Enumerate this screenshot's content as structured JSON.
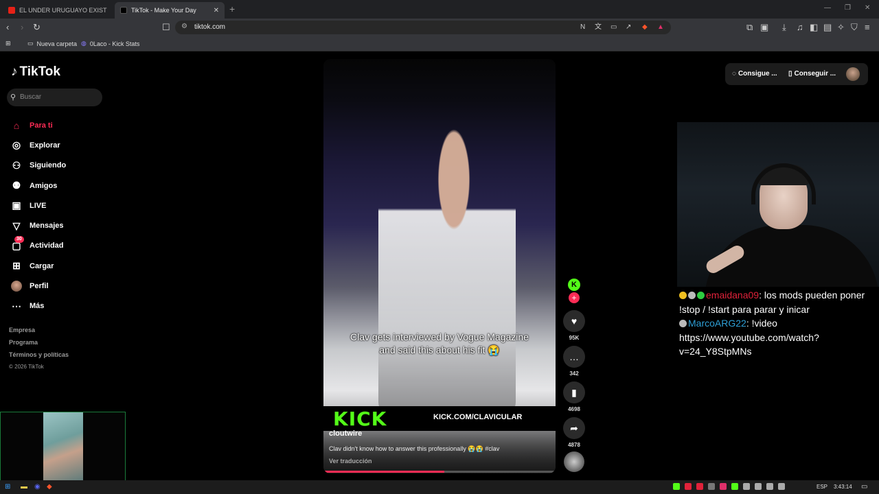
{
  "browser": {
    "tabs": [
      {
        "title": "EL UNDER URUGUAYO EXISTE? (cong",
        "active": false
      },
      {
        "title": "TikTok - Make Your Day",
        "active": true
      }
    ],
    "new_tab": "+",
    "url": "tiktok.com",
    "bookmarks": [
      "Nueva carpeta",
      "0Laco - Kick Stats"
    ]
  },
  "sidebar": {
    "logo": "TikTok",
    "search_placeholder": "Buscar",
    "items": [
      {
        "label": "Para ti",
        "icon": "home-icon"
      },
      {
        "label": "Explorar",
        "icon": "compass-icon"
      },
      {
        "label": "Siguiendo",
        "icon": "following-icon"
      },
      {
        "label": "Amigos",
        "icon": "friends-icon"
      },
      {
        "label": "LIVE",
        "icon": "live-icon"
      },
      {
        "label": "Mensajes",
        "icon": "messages-icon"
      },
      {
        "label": "Actividad",
        "icon": "activity-icon",
        "badge": "30"
      },
      {
        "label": "Cargar",
        "icon": "upload-icon"
      },
      {
        "label": "Perfil",
        "icon": "avatar"
      },
      {
        "label": "Más",
        "icon": "more-icon"
      }
    ],
    "footer": [
      "Empresa",
      "Programa",
      "Términos y políticas"
    ],
    "copyright": "© 2026 TikTok"
  },
  "video": {
    "caption": "Clav gets interviewed by Vogue Magazine and said this about his fit 😭",
    "overlay_brand": "KICK",
    "overlay_url": "KICK.COM/CLAVICULAR",
    "author": "cloutwire",
    "description": "Clav didn't know how to answer this professionally 😭😭 #clav",
    "translate": "Ver traducción",
    "progress": 0.52
  },
  "actions": {
    "creator_initial": "K",
    "likes": "95K",
    "comments": "342",
    "saves": "4698",
    "shares": "4878"
  },
  "topbar": {
    "btn1": "Consigue ...",
    "btn2": "Conseguir ..."
  },
  "chat": [
    {
      "user": "emaidana09",
      "text": ": los mods pueden poner !stop / !start para parar y inicar"
    },
    {
      "user": "MarcoARG22",
      "text": ": !video https://www.youtube.com/watch?v=24_Y8StpMNs"
    }
  ],
  "taskbar": {
    "lang": "ESP",
    "time": "3:43:14"
  },
  "colors": {
    "accent": "#fe2c55",
    "kick_green": "#53fc18"
  }
}
